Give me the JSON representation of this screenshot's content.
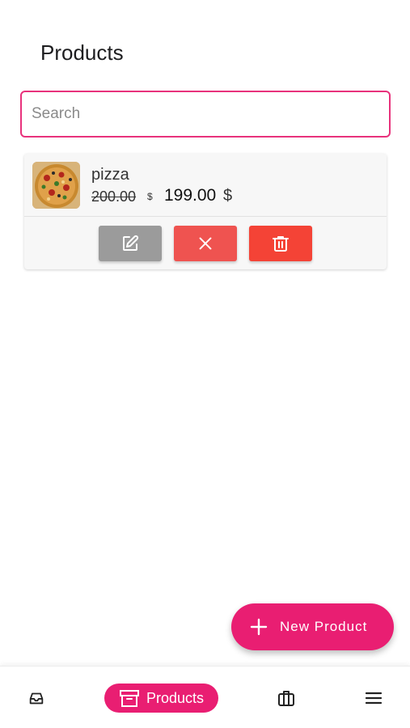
{
  "page": {
    "title": "Products"
  },
  "search": {
    "placeholder": "Search",
    "value": ""
  },
  "products": [
    {
      "name": "pizza",
      "old_price": "200.00",
      "old_currency": "$",
      "price": "199.00",
      "currency": "$",
      "image": "pizza-image"
    }
  ],
  "actions": {
    "edit_icon": "edit-icon",
    "cancel_icon": "close-icon",
    "delete_icon": "trash-icon"
  },
  "fab": {
    "label": "New Product",
    "icon": "plus-icon"
  },
  "bottom_nav": {
    "items": [
      {
        "icon": "inbox-icon",
        "label": ""
      },
      {
        "icon": "archive-box-icon",
        "label": "Products",
        "active": true
      },
      {
        "icon": "briefcase-icon",
        "label": ""
      },
      {
        "icon": "menu-icon",
        "label": ""
      }
    ]
  },
  "colors": {
    "accent": "#e91e72",
    "edit_button": "#9b9b9b",
    "cancel_button": "#ef5350",
    "delete_button": "#f44336"
  }
}
